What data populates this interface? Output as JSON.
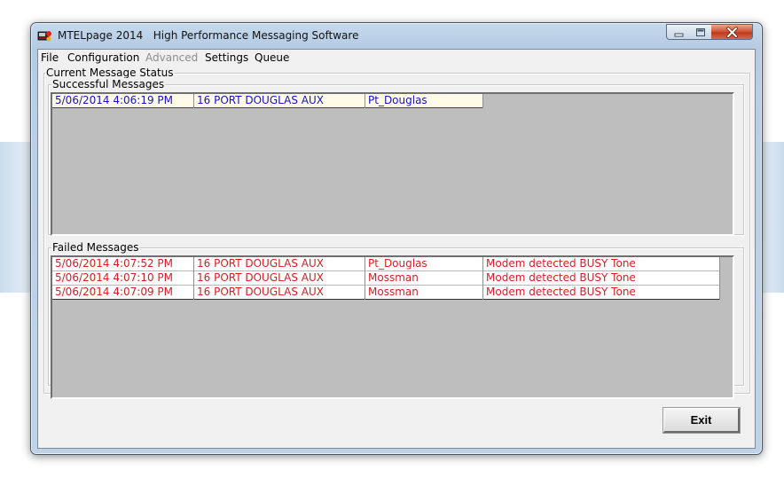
{
  "window": {
    "title": "MTELpage 2014   High Performance Messaging Software",
    "icon": "mtelpage-app-icon",
    "controls": [
      "minimize-icon",
      "maximize-icon",
      "close-icon"
    ]
  },
  "menu": {
    "items": [
      {
        "label": "File",
        "enabled": true
      },
      {
        "label": "Configuration",
        "enabled": true
      },
      {
        "label": "Advanced",
        "enabled": false
      },
      {
        "label": "Settings",
        "enabled": true
      },
      {
        "label": "Queue",
        "enabled": true
      }
    ]
  },
  "status_group": {
    "title": "Current Message Status"
  },
  "successful": {
    "title": "Successful Messages",
    "rows": [
      {
        "time": "5/06/2014 4:06:19 PM",
        "source": "16 PORT DOUGLAS AUX",
        "dest": "Pt_Douglas"
      }
    ]
  },
  "failed": {
    "title": "Failed Messages",
    "rows": [
      {
        "time": "5/06/2014 4:07:52 PM",
        "source": "16 PORT DOUGLAS AUX",
        "dest": "Pt_Douglas",
        "reason": "Modem detected BUSY Tone"
      },
      {
        "time": "5/06/2014 4:07:10 PM",
        "source": "16 PORT DOUGLAS AUX",
        "dest": "Mossman",
        "reason": "Modem detected BUSY Tone"
      },
      {
        "time": "5/06/2014 4:07:09 PM",
        "source": "16 PORT DOUGLAS AUX",
        "dest": "Mossman",
        "reason": "Modem detected BUSY Tone"
      }
    ]
  },
  "buttons": {
    "exit": "Exit"
  },
  "colors": {
    "success_text": "#1414c8",
    "failed_text": "#d42020",
    "list_background": "#bebebe",
    "success_row_bg": "#fffbe8"
  }
}
